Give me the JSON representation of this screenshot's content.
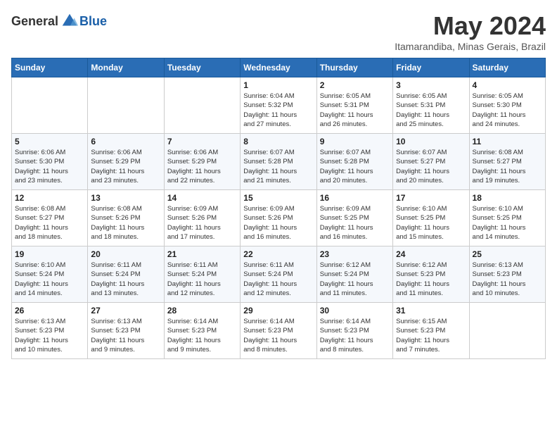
{
  "logo": {
    "text_general": "General",
    "text_blue": "Blue"
  },
  "title": {
    "month_year": "May 2024",
    "location": "Itamarandiba, Minas Gerais, Brazil"
  },
  "weekdays": [
    "Sunday",
    "Monday",
    "Tuesday",
    "Wednesday",
    "Thursday",
    "Friday",
    "Saturday"
  ],
  "weeks": [
    [
      {
        "day": "",
        "info": ""
      },
      {
        "day": "",
        "info": ""
      },
      {
        "day": "",
        "info": ""
      },
      {
        "day": "1",
        "info": "Sunrise: 6:04 AM\nSunset: 5:32 PM\nDaylight: 11 hours\nand 27 minutes."
      },
      {
        "day": "2",
        "info": "Sunrise: 6:05 AM\nSunset: 5:31 PM\nDaylight: 11 hours\nand 26 minutes."
      },
      {
        "day": "3",
        "info": "Sunrise: 6:05 AM\nSunset: 5:31 PM\nDaylight: 11 hours\nand 25 minutes."
      },
      {
        "day": "4",
        "info": "Sunrise: 6:05 AM\nSunset: 5:30 PM\nDaylight: 11 hours\nand 24 minutes."
      }
    ],
    [
      {
        "day": "5",
        "info": "Sunrise: 6:06 AM\nSunset: 5:30 PM\nDaylight: 11 hours\nand 23 minutes."
      },
      {
        "day": "6",
        "info": "Sunrise: 6:06 AM\nSunset: 5:29 PM\nDaylight: 11 hours\nand 23 minutes."
      },
      {
        "day": "7",
        "info": "Sunrise: 6:06 AM\nSunset: 5:29 PM\nDaylight: 11 hours\nand 22 minutes."
      },
      {
        "day": "8",
        "info": "Sunrise: 6:07 AM\nSunset: 5:28 PM\nDaylight: 11 hours\nand 21 minutes."
      },
      {
        "day": "9",
        "info": "Sunrise: 6:07 AM\nSunset: 5:28 PM\nDaylight: 11 hours\nand 20 minutes."
      },
      {
        "day": "10",
        "info": "Sunrise: 6:07 AM\nSunset: 5:27 PM\nDaylight: 11 hours\nand 20 minutes."
      },
      {
        "day": "11",
        "info": "Sunrise: 6:08 AM\nSunset: 5:27 PM\nDaylight: 11 hours\nand 19 minutes."
      }
    ],
    [
      {
        "day": "12",
        "info": "Sunrise: 6:08 AM\nSunset: 5:27 PM\nDaylight: 11 hours\nand 18 minutes."
      },
      {
        "day": "13",
        "info": "Sunrise: 6:08 AM\nSunset: 5:26 PM\nDaylight: 11 hours\nand 18 minutes."
      },
      {
        "day": "14",
        "info": "Sunrise: 6:09 AM\nSunset: 5:26 PM\nDaylight: 11 hours\nand 17 minutes."
      },
      {
        "day": "15",
        "info": "Sunrise: 6:09 AM\nSunset: 5:26 PM\nDaylight: 11 hours\nand 16 minutes."
      },
      {
        "day": "16",
        "info": "Sunrise: 6:09 AM\nSunset: 5:25 PM\nDaylight: 11 hours\nand 16 minutes."
      },
      {
        "day": "17",
        "info": "Sunrise: 6:10 AM\nSunset: 5:25 PM\nDaylight: 11 hours\nand 15 minutes."
      },
      {
        "day": "18",
        "info": "Sunrise: 6:10 AM\nSunset: 5:25 PM\nDaylight: 11 hours\nand 14 minutes."
      }
    ],
    [
      {
        "day": "19",
        "info": "Sunrise: 6:10 AM\nSunset: 5:24 PM\nDaylight: 11 hours\nand 14 minutes."
      },
      {
        "day": "20",
        "info": "Sunrise: 6:11 AM\nSunset: 5:24 PM\nDaylight: 11 hours\nand 13 minutes."
      },
      {
        "day": "21",
        "info": "Sunrise: 6:11 AM\nSunset: 5:24 PM\nDaylight: 11 hours\nand 12 minutes."
      },
      {
        "day": "22",
        "info": "Sunrise: 6:11 AM\nSunset: 5:24 PM\nDaylight: 11 hours\nand 12 minutes."
      },
      {
        "day": "23",
        "info": "Sunrise: 6:12 AM\nSunset: 5:24 PM\nDaylight: 11 hours\nand 11 minutes."
      },
      {
        "day": "24",
        "info": "Sunrise: 6:12 AM\nSunset: 5:23 PM\nDaylight: 11 hours\nand 11 minutes."
      },
      {
        "day": "25",
        "info": "Sunrise: 6:13 AM\nSunset: 5:23 PM\nDaylight: 11 hours\nand 10 minutes."
      }
    ],
    [
      {
        "day": "26",
        "info": "Sunrise: 6:13 AM\nSunset: 5:23 PM\nDaylight: 11 hours\nand 10 minutes."
      },
      {
        "day": "27",
        "info": "Sunrise: 6:13 AM\nSunset: 5:23 PM\nDaylight: 11 hours\nand 9 minutes."
      },
      {
        "day": "28",
        "info": "Sunrise: 6:14 AM\nSunset: 5:23 PM\nDaylight: 11 hours\nand 9 minutes."
      },
      {
        "day": "29",
        "info": "Sunrise: 6:14 AM\nSunset: 5:23 PM\nDaylight: 11 hours\nand 8 minutes."
      },
      {
        "day": "30",
        "info": "Sunrise: 6:14 AM\nSunset: 5:23 PM\nDaylight: 11 hours\nand 8 minutes."
      },
      {
        "day": "31",
        "info": "Sunrise: 6:15 AM\nSunset: 5:23 PM\nDaylight: 11 hours\nand 7 minutes."
      },
      {
        "day": "",
        "info": ""
      }
    ]
  ]
}
